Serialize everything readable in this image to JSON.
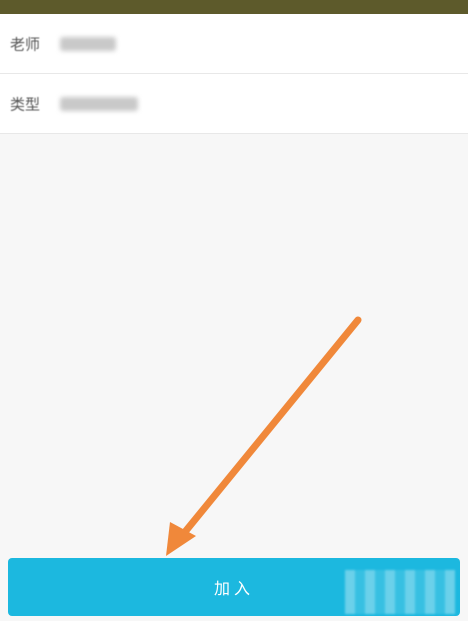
{
  "rows": [
    {
      "label": "老师"
    },
    {
      "label": "类型"
    }
  ],
  "join_button": {
    "label": "加入"
  },
  "colors": {
    "top_bar": "#5d5a2b",
    "button": "#1cb8df",
    "annotation_arrow": "#f0883a"
  }
}
